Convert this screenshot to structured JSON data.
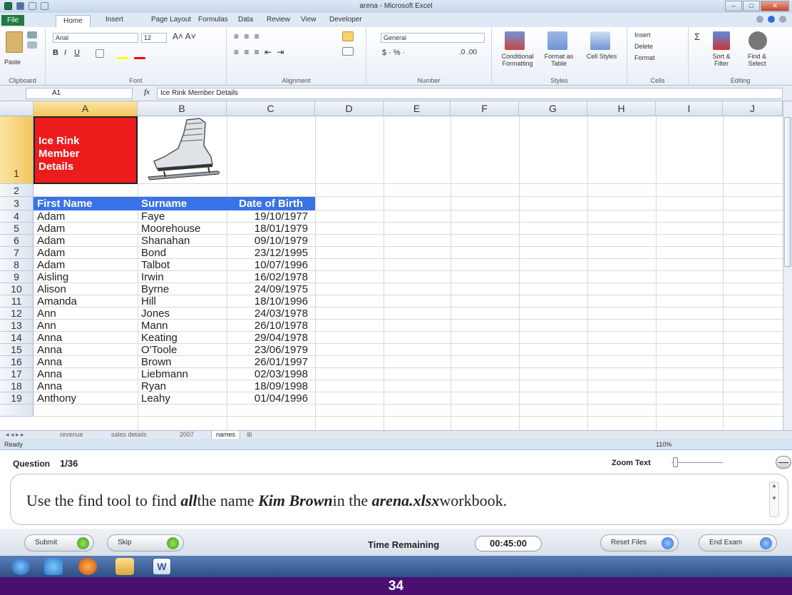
{
  "window": {
    "title": "arena - Microsoft Excel"
  },
  "ribbon": {
    "tabs": [
      "File",
      "Home",
      "Insert",
      "Page Layout",
      "Formulas",
      "Data",
      "Review",
      "View",
      "Developer"
    ],
    "clipboard": {
      "paste": "Paste",
      "group": "Clipboard"
    },
    "font": {
      "name": "Arial",
      "size": "12",
      "group": "Font"
    },
    "alignment": {
      "group": "Alignment"
    },
    "number": {
      "format": "General",
      "group": "Number"
    },
    "styles": {
      "conditional": "Conditional Formatting",
      "format_table": "Format as Table",
      "cell_styles": "Cell Styles",
      "group": "Styles"
    },
    "cells": {
      "insert": "Insert",
      "delete": "Delete",
      "format": "Format",
      "group": "Cells"
    },
    "editing": {
      "sort": "Sort & Filter",
      "find": "Find & Select",
      "group": "Editing"
    }
  },
  "formula_bar": {
    "name_box": "A1",
    "fx": "fx",
    "content": "Ice Rink Member Details"
  },
  "columns": [
    "A",
    "B",
    "C",
    "D",
    "E",
    "F",
    "G",
    "H",
    "I",
    "J"
  ],
  "sheet": {
    "a1": "Ice Rink\nMember\nDetails",
    "headers": [
      "First Name",
      "Surname",
      "Date of Birth"
    ],
    "rows": [
      {
        "n": "4",
        "first": "Adam",
        "last": "Faye",
        "dob": "19/10/1977"
      },
      {
        "n": "5",
        "first": "Adam",
        "last": "Moorehouse",
        "dob": "18/01/1979"
      },
      {
        "n": "6",
        "first": "Adam",
        "last": "Shanahan",
        "dob": "09/10/1979"
      },
      {
        "n": "7",
        "first": "Adam",
        "last": "Bond",
        "dob": "23/12/1995"
      },
      {
        "n": "8",
        "first": "Adam",
        "last": "Talbot",
        "dob": "10/07/1996"
      },
      {
        "n": "9",
        "first": "Aisling",
        "last": "Irwin",
        "dob": "16/02/1978"
      },
      {
        "n": "10",
        "first": "Alison",
        "last": "Byrne",
        "dob": "24/09/1975"
      },
      {
        "n": "11",
        "first": "Amanda",
        "last": "Hill",
        "dob": "18/10/1996"
      },
      {
        "n": "12",
        "first": "Ann",
        "last": "Jones",
        "dob": "24/03/1978"
      },
      {
        "n": "13",
        "first": "Ann",
        "last": "Mann",
        "dob": "26/10/1978"
      },
      {
        "n": "14",
        "first": "Anna",
        "last": "Keating",
        "dob": "29/04/1978"
      },
      {
        "n": "15",
        "first": "Anna",
        "last": "O'Toole",
        "dob": "23/06/1979"
      },
      {
        "n": "16",
        "first": "Anna",
        "last": "Brown",
        "dob": "26/01/1997"
      },
      {
        "n": "17",
        "first": "Anna",
        "last": "Liebmann",
        "dob": "02/03/1998"
      },
      {
        "n": "18",
        "first": "Anna",
        "last": "Ryan",
        "dob": "18/09/1998"
      },
      {
        "n": "19",
        "first": "Anthony",
        "last": "Leahy",
        "dob": "01/04/1996"
      }
    ]
  },
  "sheet_tabs": [
    "revenue",
    "sales details",
    "2007",
    "names"
  ],
  "status": {
    "ready": "Ready",
    "zoom": "110%"
  },
  "exam": {
    "question_label": "Question",
    "question_num": "1/36",
    "zoom_text": "Zoom Text",
    "q_parts": [
      "Use the find tool to find ",
      "all",
      "the name ",
      "Kim Brown",
      "in the ",
      "arena.xlsx",
      "workbook."
    ],
    "submit": "Submit",
    "skip": "Skip",
    "time_label": "Time Remaining",
    "time": "00:45:00",
    "reset": "Reset Files",
    "end": "End Exam"
  },
  "slide_number": "34",
  "colors": {
    "header_blue": "#3a73e8",
    "title_red": "#ed1c1c",
    "slide_purple": "#4b0f72",
    "excel_green": "#1f7a3f"
  }
}
